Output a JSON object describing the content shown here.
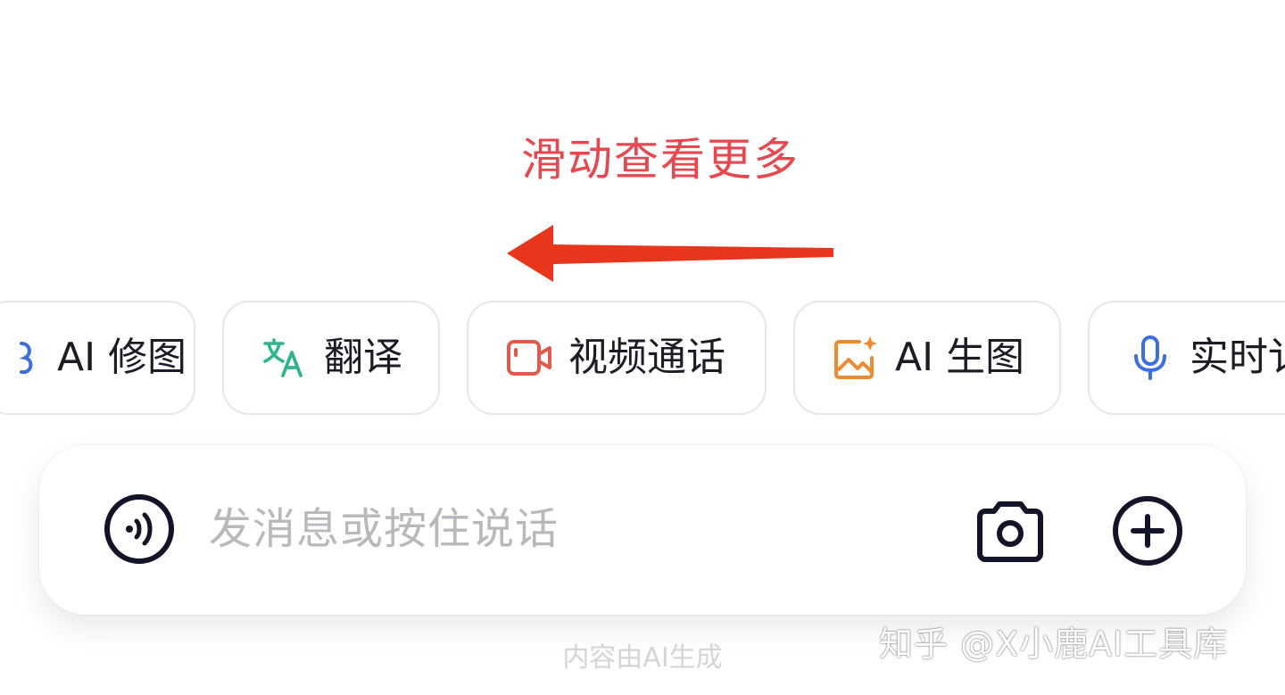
{
  "hint": {
    "text": "滑动查看更多",
    "color": "#e8474f",
    "arrow_color": "#e8361c",
    "arrow_direction": "left"
  },
  "chips": [
    {
      "label": "AI 修图",
      "icon": "ai-retouch-icon",
      "color": "#3b6fe0"
    },
    {
      "label": "翻译",
      "icon": "translate-icon",
      "color": "#2fb58a"
    },
    {
      "label": "视频通话",
      "icon": "video-call-icon",
      "color": "#e25a4c"
    },
    {
      "label": "AI 生图",
      "icon": "ai-image-icon",
      "color": "#f08a2c"
    },
    {
      "label": "实时讠",
      "icon": "microphone-icon",
      "color": "#3b6fe0"
    }
  ],
  "input": {
    "placeholder": "发消息或按住说话",
    "voice_icon": "voice-wave-icon",
    "camera_icon": "camera-icon",
    "plus_icon": "plus-circle-icon",
    "icon_color": "#141428"
  },
  "footer": {
    "note": "内容由AI生成"
  },
  "watermark": {
    "text": "知乎 @X小鹿AI工具库"
  }
}
